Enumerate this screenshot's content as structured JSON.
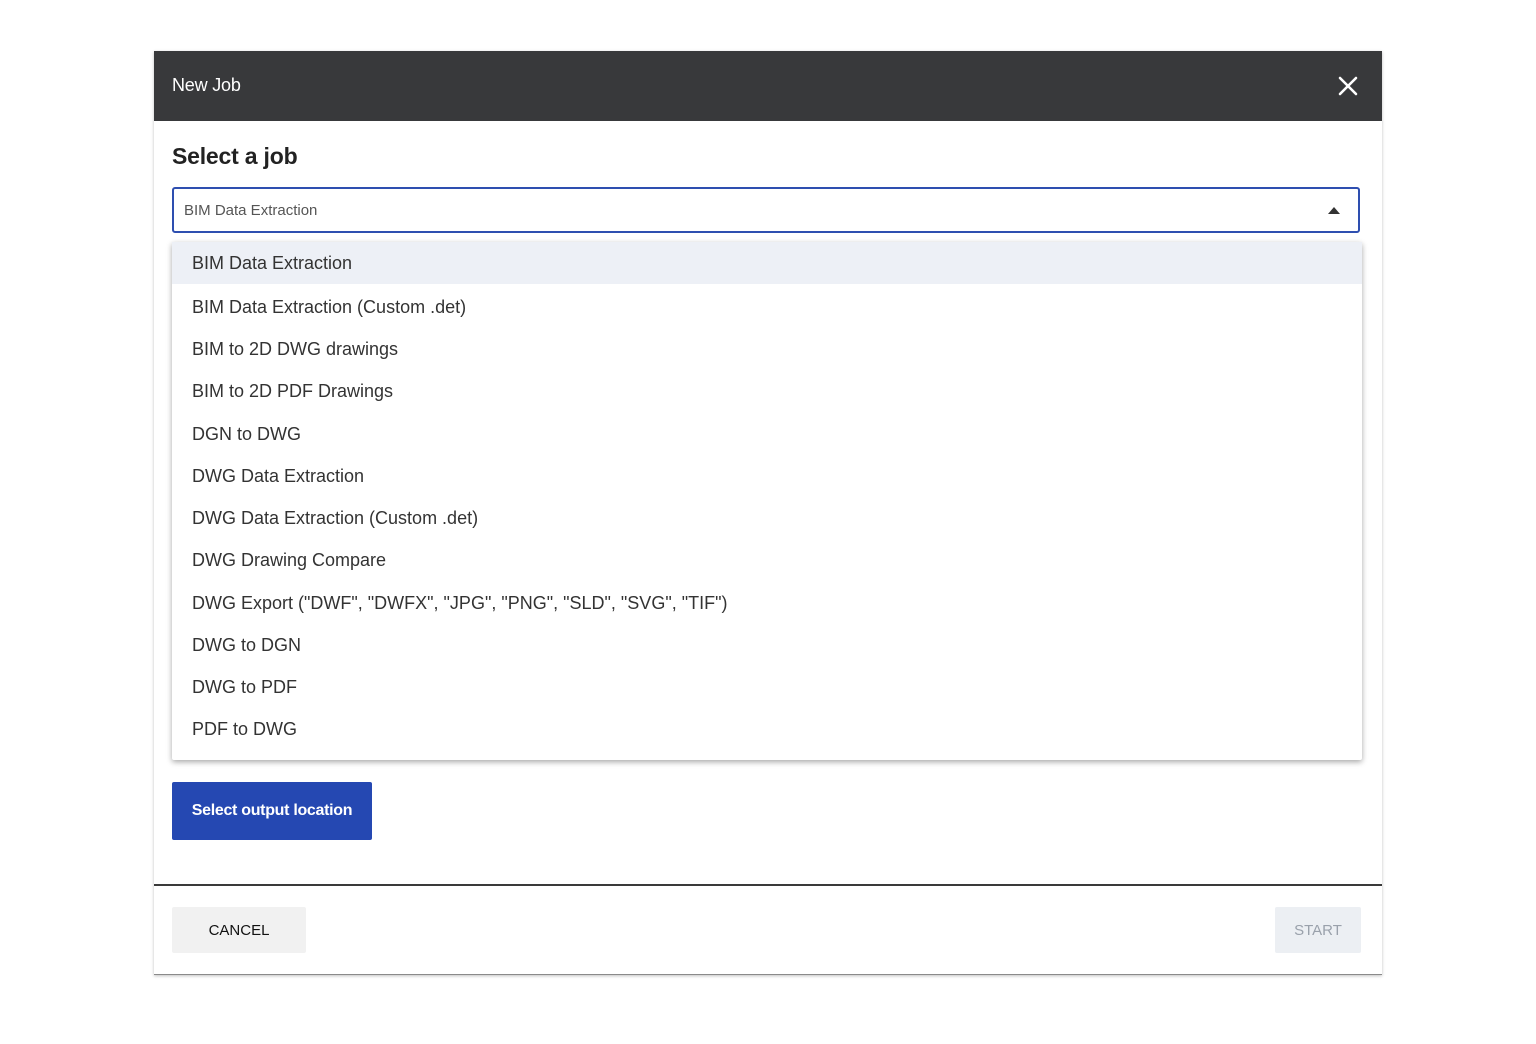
{
  "dialog": {
    "title": "New Job",
    "close_icon": "close-icon",
    "heading": "Select a job"
  },
  "job_select": {
    "value": "BIM Data Extraction",
    "caret_icon": "caret-up-icon",
    "options": [
      "BIM Data Extraction",
      "BIM Data Extraction (Custom .det)",
      "BIM to 2D DWG drawings",
      "BIM to 2D PDF Drawings",
      "DGN to DWG",
      "DWG Data Extraction",
      "DWG Data Extraction (Custom .det)",
      "DWG Drawing Compare",
      "DWG Export (\"DWF\", \"DWFX\", \"JPG\", \"PNG\", \"SLD\", \"SVG\", \"TIF\")",
      "DWG to DGN",
      "DWG to PDF",
      "PDF to DWG"
    ],
    "selected_index": 0
  },
  "output_location_button": "Select output location",
  "footer": {
    "cancel_label": "CANCEL",
    "start_label": "START",
    "start_disabled": true
  },
  "colors": {
    "titlebar": "#38393b",
    "accent": "#2548b2",
    "selected_option_bg": "#edf0f6"
  }
}
